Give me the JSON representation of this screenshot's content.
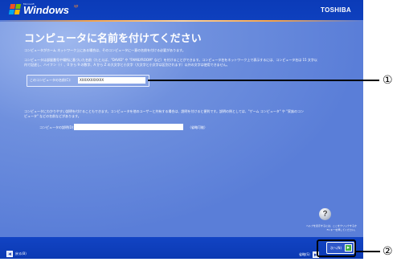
{
  "header": {
    "ms_label": "Microsoft",
    "windows_text": "Windows",
    "xp_text": "xp",
    "brand": "TOSHIBA"
  },
  "page": {
    "title": "コンピュータに名前を付けてください",
    "para1": "コンピュータがホーム ネットワーク上にある場合は、そのコンピュータに一意の名前を付ける必要があります。",
    "para2_line1": "コンピュータは部屋番号や場所に基づいた名前（たとえば、\"DAVID\" や \"FAMILYROOM\" など）を付けることができます。コンピュータ名をネットワーク上で表示するには、コンピュータ名は 15 文字以",
    "para2_line2": "内で記述し、ハイフン（-）、0 から 9 の数字、A から Z の大文字と小文字（大文字と小文字は区別されます）以外の文字は使用できません。",
    "name_label": "このコンピュータの名前(C):",
    "name_value": "XXXXXXXXXXX",
    "para3_line1": "コンピュータにわかりやすい説明を付けることもできます。コンピュータを他のユーザーと共有する場合は、説明を付けると便利です。説明の例としては、\"ゲーム コンピュータ\" や \"家族のコン",
    "para3_line2": "ピュータ\" などの名前などがあります。",
    "desc_label": "コンピュータの説明(D):",
    "desc_value": "",
    "desc_hint": "（省略可能）",
    "help_icon": "?",
    "help_line1": "ヘルプを表示するには、ここをクリックするか",
    "help_line2": "F1 キーを押してください。"
  },
  "footer": {
    "back_arrow": "◂",
    "back_label": "戻る(B)",
    "skip_label": "省略(S)",
    "skip_arrow": "▸",
    "next_label": "次へ(N)",
    "next_arrow": "▸"
  },
  "callouts": {
    "c1": "①",
    "c2": "②"
  },
  "colors": {
    "screen_bg": "#5a7ed8",
    "bar_bg": "#0b3bb8",
    "accent_orange": "#f5a34a",
    "next_green": "#3fae3f"
  }
}
